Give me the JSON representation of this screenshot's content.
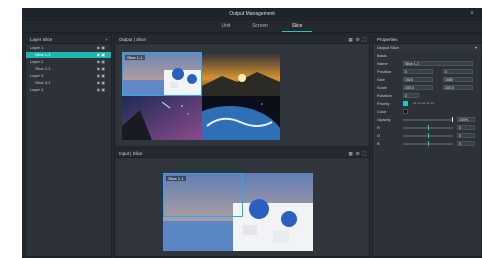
{
  "window": {
    "title": "Output Management"
  },
  "tabs": [
    "Unit",
    "Screen",
    "Slice"
  ],
  "layers_panel": {
    "title": "Layer Slice",
    "items": [
      {
        "label": "Layer 1"
      },
      {
        "label": "Slice 1-1",
        "selected": true
      },
      {
        "label": "Layer 2"
      },
      {
        "label": "Slice 2-1"
      },
      {
        "label": "Layer 3"
      },
      {
        "label": "Slice 3-1"
      },
      {
        "label": "Layer 4"
      }
    ]
  },
  "output_panel": {
    "title": "Output | Slice",
    "slice_tag": "Slice 1-1"
  },
  "input_panel": {
    "title": "Input | Slice",
    "slice_tag": "Slice 1-1"
  },
  "properties": {
    "title": "Properties",
    "section": "Output Slice",
    "rows": [
      {
        "key": "Basic"
      },
      {
        "key": "Name",
        "value": "Slice 1-1"
      },
      {
        "key": "Position",
        "x": "0",
        "y": "0"
      },
      {
        "key": "Size",
        "w": "1920",
        "h": "1080"
      },
      {
        "key": "Scale",
        "a": "100.0",
        "b": "100.0"
      },
      {
        "key": "Rotation",
        "value": "0"
      },
      {
        "key": "Priority"
      },
      {
        "key": "Color"
      },
      {
        "key": "Opacity",
        "value": "100%"
      },
      {
        "key": "R",
        "value": "0"
      },
      {
        "key": "G",
        "value": "0"
      },
      {
        "key": "B",
        "value": "0"
      }
    ]
  },
  "colors": {
    "accent": "#20c7c4",
    "selection": "#24a7ff",
    "bg": "#262b32"
  }
}
